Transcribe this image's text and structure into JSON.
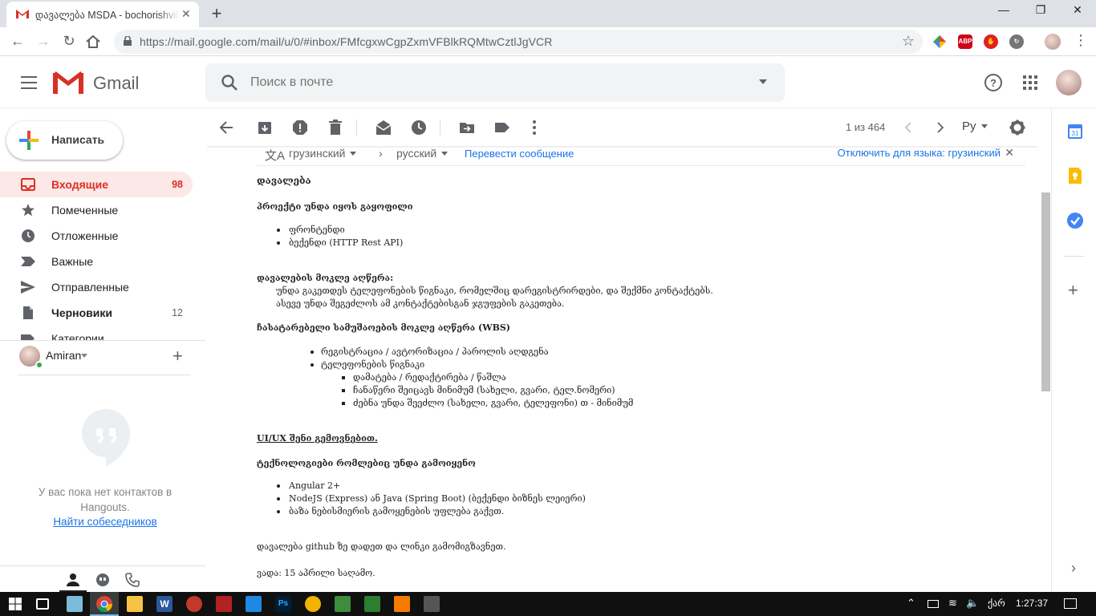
{
  "browser": {
    "tab_title": "დავალება MSDA - bochorishvili",
    "url_host": "https://mail.google.com",
    "url_path": "/mail/u/0/#inbox/FMfcgxwCgpZxmVFBlkRQMtwCztlJgVCR",
    "extensions": [
      {
        "name": "google-apps-icon",
        "label": ""
      },
      {
        "name": "adblock-plus-icon",
        "label": "ABP",
        "color": "#d0021b"
      },
      {
        "name": "adblock-icon",
        "label": "",
        "color": "#e0201a"
      },
      {
        "name": "refresh-extension-icon",
        "label": "",
        "color": "#757575"
      }
    ]
  },
  "gmail": {
    "logo_text": "Gmail",
    "search_placeholder": "Поиск в почте",
    "compose_label": "Написать",
    "folders": [
      {
        "name": "inbox",
        "label": "Входящие",
        "count": "98",
        "active": true,
        "icon": "inbox-icon"
      },
      {
        "name": "starred",
        "label": "Помеченные",
        "count": "",
        "icon": "star-icon"
      },
      {
        "name": "snoozed",
        "label": "Отложенные",
        "count": "",
        "icon": "clock-icon"
      },
      {
        "name": "important",
        "label": "Важные",
        "count": "",
        "icon": "important-icon"
      },
      {
        "name": "sent",
        "label": "Отправленные",
        "count": "",
        "icon": "send-icon"
      },
      {
        "name": "drafts",
        "label": "Черновики",
        "count": "12",
        "icon": "draft-icon",
        "bold": true
      },
      {
        "name": "categories",
        "label": "Категории",
        "count": "",
        "icon": "label-icon"
      }
    ],
    "hangouts": {
      "user": "Amiran",
      "empty_text": "У вас пока нет контактов в Hangouts.",
      "find_link": "Найти собеседников"
    },
    "pager": "1 из 464",
    "language_button": "Ру",
    "translation": {
      "source": "грузинский",
      "target": "русский",
      "translate_link": "Перевести сообщение",
      "disable_link": "Отключить для языка: грузинский"
    }
  },
  "email": {
    "title": "დავალება",
    "section1_heading": "პროექტი უნდა იყოს გაყოფილი",
    "section1_items": [
      "ფრონტენდი",
      "ბექენდი (HTTP Rest API)"
    ],
    "section2_heading": "დავალების მოკლე აღწერა:",
    "section2_lines": [
      "უნდა გაკეთდეს ტელეფონების წიგნაკი, რომელშიც დარეგისტრირდები, და შექმნი კონტაქტებს.",
      "ასევე უნდა შეგეძლოს ამ კონტაქტებისგან ჯგუფების გაკეთება."
    ],
    "section3_heading": "ჩასატარებელი სამუშაოების მოკლე აღწერა (WBS)",
    "section3_items": [
      "რეგისტრაცია / ავტორიზაცია / პაროლის აღდგენა",
      "ტელეფონების წიგნაკი"
    ],
    "section3_subitems": [
      "დამატება / რედაქტირება / წაშლა",
      "ჩანაწერი შეიცავს მინიმუმ (სახელი, გვარი, ტელ.ნომერი)",
      "ძებნა უნდა შეეძლო (სახელი, გვარი, ტელეფონი) თ - მინიმუმ"
    ],
    "ux_line": "UI/UX შენი გემოვნებით.",
    "section4_heading": "ტექნოლოგიები რომლებიც უნდა გამოიყენო",
    "section4_items": [
      "Angular 2+",
      "NodeJS (Express) ან Java (Spring Boot) (ბექენდი ბიზნეს ლეიერი)",
      "ბაზა ნებისმიერის გამოყენების უფლება გაქვთ."
    ],
    "github_line": "დავალება github ზე დადეთ და ლინკი გამომიგზავნეთ.",
    "deadline_line": "ვადა: 15 აპრილი საღამო."
  },
  "taskbar": {
    "lang": "ქარ",
    "time": "1:27:37"
  },
  "colors": {
    "gmail_red": "#d93025",
    "link_blue": "#1a73e8",
    "active_folder_bg": "#fce8e6"
  }
}
